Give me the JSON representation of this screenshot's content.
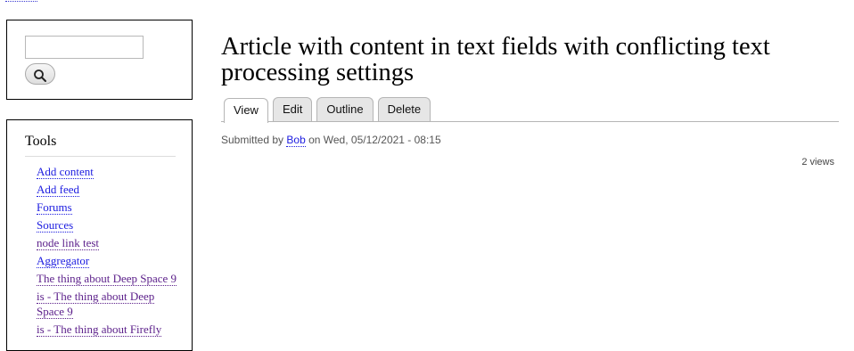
{
  "search": {
    "value": "",
    "placeholder": "",
    "button_icon": "search-icon"
  },
  "tools": {
    "title": "Tools",
    "items": [
      {
        "label": "Add content"
      },
      {
        "label": "Add feed"
      },
      {
        "label": "Forums"
      },
      {
        "label": "Sources"
      },
      {
        "label": "node link test"
      },
      {
        "label": "Aggregator"
      },
      {
        "label": "The thing about Deep Space 9"
      },
      {
        "label": "is - The thing about Deep Space 9"
      },
      {
        "label": "is - The thing about Firefly"
      }
    ]
  },
  "main": {
    "title": "Article with content in text fields with conflicting text processing settings",
    "tabs": [
      {
        "label": "View"
      },
      {
        "label": "Edit"
      },
      {
        "label": "Outline"
      },
      {
        "label": "Delete"
      }
    ],
    "submitted": {
      "prefix": "Submitted by",
      "author": "Bob",
      "middle": "on Wed, 05/12/2021 - 08:15"
    },
    "views": "2 views"
  },
  "colors": {
    "link": "#1d1de0",
    "link_visited": "#5b1f8a",
    "tab_background": "#e6e6e6",
    "border": "#000000"
  }
}
